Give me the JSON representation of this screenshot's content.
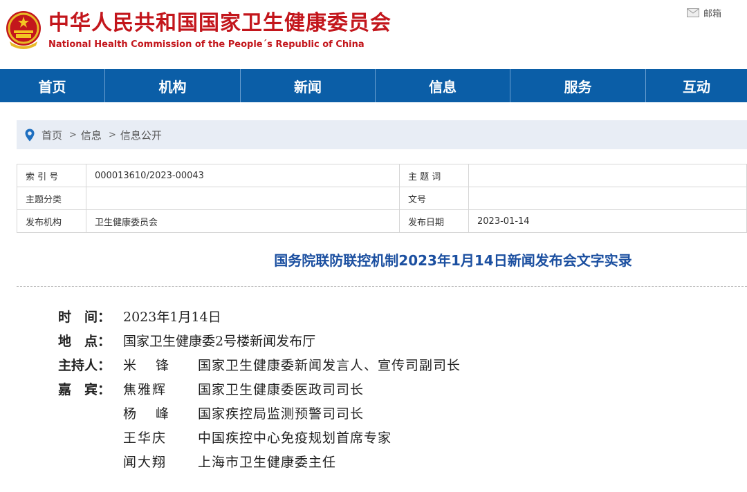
{
  "header": {
    "title_cn": "中华人民共和国国家卫生健康委员会",
    "title_en": "National Health Commission of the People´s Republic of China",
    "mail_label": "邮箱",
    "emblem_icon": "national-emblem-icon"
  },
  "nav": {
    "items": [
      {
        "label": "首页"
      },
      {
        "label": "机构"
      },
      {
        "label": "新闻"
      },
      {
        "label": "信息"
      },
      {
        "label": "服务"
      },
      {
        "label": "互动"
      }
    ]
  },
  "breadcrumb": {
    "items": [
      "首页",
      "信息",
      "信息公开"
    ],
    "separator": ">"
  },
  "meta": {
    "index_label": "索 引 号",
    "index_value": "000013610/2023-00043",
    "subject_label": "主 题 词",
    "subject_value": "",
    "category_label": "主题分类",
    "category_value": "",
    "docno_label": "文号",
    "docno_value": "",
    "publisher_label": "发布机构",
    "publisher_value": "卫生健康委员会",
    "date_label": "发布日期",
    "date_value": "2023-01-14"
  },
  "article": {
    "title": "国务院联防联控机制2023年1月14日新闻发布会文字实录",
    "time_label": [
      "时",
      "间："
    ],
    "time_value": "2023年1月14日",
    "place_label": [
      "地",
      "点："
    ],
    "place_value": "国家卫生健康委2号楼新闻发布厅",
    "host_label": "主持人：",
    "host": {
      "name": [
        "米",
        "锋"
      ],
      "role": "国家卫生健康委新闻发言人、宣传司副司长"
    },
    "guests_label": [
      "嘉",
      "宾："
    ],
    "guests": [
      {
        "name": "焦雅辉",
        "role": "国家卫生健康委医政司司长"
      },
      {
        "name": [
          "杨",
          "峰"
        ],
        "role": "国家疾控局监测预警司司长"
      },
      {
        "name": "王华庆",
        "role": "中国疾控中心免疫规划首席专家"
      },
      {
        "name": "闻大翔",
        "role": "上海市卫生健康委主任"
      }
    ]
  },
  "colors": {
    "brand_red": "#c3161c",
    "nav_blue": "#0b5ea7",
    "title_blue": "#1b4fa0",
    "crumb_bg": "#e8edf5"
  }
}
